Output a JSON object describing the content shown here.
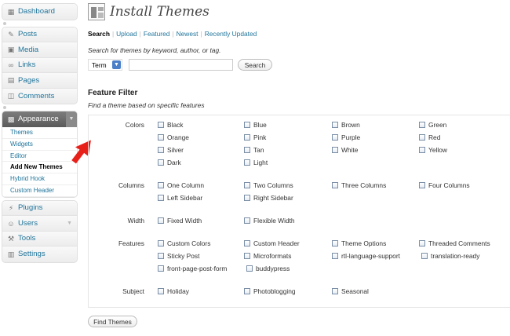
{
  "sidebar": {
    "dashboard": "Dashboard",
    "group2": [
      "Posts",
      "Media",
      "Links",
      "Pages",
      "Comments"
    ],
    "appearance": "Appearance",
    "appearance_sub": [
      "Themes",
      "Widgets",
      "Editor",
      "Add New Themes",
      "Hybrid Hook",
      "Custom Header"
    ],
    "group4": [
      "Plugins",
      "Users",
      "Tools",
      "Settings"
    ]
  },
  "page": {
    "title": "Install Themes",
    "subnav": [
      "Search",
      "Upload",
      "Featured",
      "Newest",
      "Recently Updated"
    ],
    "search_hint": "Search for themes by keyword, author, or tag.",
    "term_value": "Term",
    "search_input_value": "",
    "search_button": "Search",
    "filter_title": "Feature Filter",
    "filter_hint": "Find a theme based on specific features",
    "find_button": "Find Themes"
  },
  "filters": {
    "colors_label": "Colors",
    "colors": [
      "Black",
      "Blue",
      "Brown",
      "Green",
      "Orange",
      "Pink",
      "Purple",
      "Red",
      "Silver",
      "Tan",
      "White",
      "Yellow",
      "Dark",
      "Light"
    ],
    "columns_label": "Columns",
    "columns": [
      "One Column",
      "Two Columns",
      "Three Columns",
      "Four Columns",
      "Left Sidebar",
      "Right Sidebar"
    ],
    "width_label": "Width",
    "width": [
      "Fixed Width",
      "Flexible Width"
    ],
    "features_label": "Features",
    "features": [
      "Custom Colors",
      "Custom Header",
      "Theme Options",
      "Threaded Comments",
      "Sticky Post",
      "Microformats",
      "rtl-language-support",
      "translation-ready",
      "front-page-post-form",
      "buddypress"
    ],
    "subject_label": "Subject",
    "subject": [
      "Holiday",
      "Photoblogging",
      "Seasonal"
    ]
  },
  "colors": {
    "link": "#21759b",
    "arrow": "#e8201a"
  }
}
